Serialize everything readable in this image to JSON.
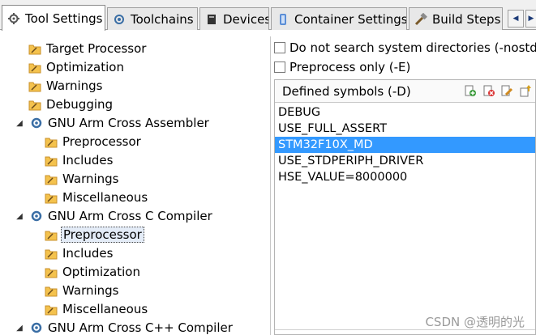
{
  "tabs": [
    {
      "label": "Tool Settings",
      "icon": "settings-icon",
      "active": true
    },
    {
      "label": "Toolchains",
      "icon": "toolchains-icon",
      "active": false
    },
    {
      "label": "Devices",
      "icon": "devices-icon",
      "active": false
    },
    {
      "label": "Container Settings",
      "icon": "container-icon",
      "active": false
    },
    {
      "label": "Build Steps",
      "icon": "build-steps-icon",
      "active": false
    }
  ],
  "tree": [
    {
      "label": "Target Processor",
      "type": "item"
    },
    {
      "label": "Optimization",
      "type": "item"
    },
    {
      "label": "Warnings",
      "type": "item"
    },
    {
      "label": "Debugging",
      "type": "item"
    },
    {
      "label": "GNU Arm Cross Assembler",
      "type": "tool"
    },
    {
      "label": "Preprocessor",
      "type": "item"
    },
    {
      "label": "Includes",
      "type": "item"
    },
    {
      "label": "Warnings",
      "type": "item"
    },
    {
      "label": "Miscellaneous",
      "type": "item"
    },
    {
      "label": "GNU Arm Cross C Compiler",
      "type": "tool"
    },
    {
      "label": "Preprocessor",
      "type": "item",
      "selected": true
    },
    {
      "label": "Includes",
      "type": "item"
    },
    {
      "label": "Optimization",
      "type": "item"
    },
    {
      "label": "Warnings",
      "type": "item"
    },
    {
      "label": "Miscellaneous",
      "type": "item"
    },
    {
      "label": "GNU Arm Cross C++ Compiler",
      "type": "tool"
    }
  ],
  "options": {
    "no_std_dirs": {
      "label": "Do not search system directories (-nostdinc)",
      "checked": false
    },
    "preprocess_only": {
      "label": "Preprocess only (-E)",
      "checked": false
    }
  },
  "defined_symbols": {
    "title": "Defined symbols (-D)",
    "tools": [
      "add-icon",
      "delete-icon",
      "edit-icon",
      "move-up-icon"
    ],
    "items": [
      "DEBUG",
      "USE_FULL_ASSERT",
      "STM32F10X_MD",
      "USE_STDPERIPH_DRIVER",
      "HSE_VALUE=8000000"
    ],
    "selected": "STM32F10X_MD"
  },
  "watermark": "CSDN @透明的光",
  "colors": {
    "selection": "#3399ff",
    "folder": "#f4c24d"
  }
}
